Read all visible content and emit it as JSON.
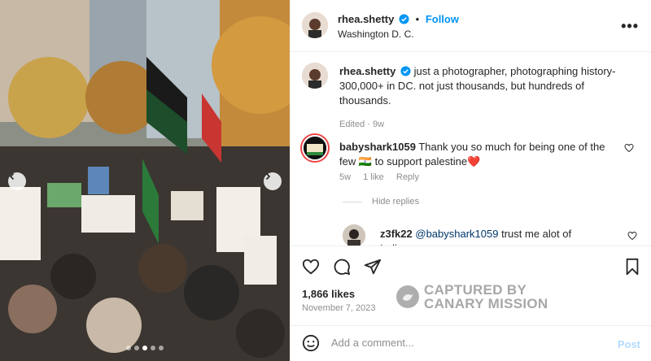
{
  "post": {
    "author": "rhea.shetty",
    "location": "Washington D. C.",
    "follow_label": "Follow",
    "follow_separator": "•",
    "more_label": "•••",
    "photo_dots": 5,
    "photo_active_dot": 2
  },
  "caption": {
    "username": "rhea.shetty",
    "text": "just a photographer, photographing history- 300,000+ in DC. not just thousands, but hundreds of thousands.",
    "edited": "Edited · 9w"
  },
  "comments": [
    {
      "username": "babyshark1059",
      "text": "Thank you so much for being one of the few 🇮🇳 to support palestine❤️",
      "time": "5w",
      "likes": "1 like",
      "reply_label": "Reply"
    }
  ],
  "hide_replies_label": "Hide replies",
  "reply": {
    "username": "z3fk22",
    "mention": "@babyshark1059",
    "text": "trust me alot of Indians"
  },
  "stats": {
    "likes": "1,866 likes",
    "date": "November 7, 2023"
  },
  "watermark": {
    "line1": "CAPTURED BY",
    "line2": "CANARY MISSION"
  },
  "composer": {
    "placeholder": "Add a comment...",
    "post_label": "Post"
  },
  "colors": {
    "link_blue": "#0095f6",
    "post_disabled": "#b3dbff",
    "muted": "#8e8e8e"
  },
  "icons": [
    "heart-icon",
    "comment-icon",
    "share-icon",
    "bookmark-icon",
    "emoji-icon",
    "verified-icon",
    "more-icon"
  ]
}
